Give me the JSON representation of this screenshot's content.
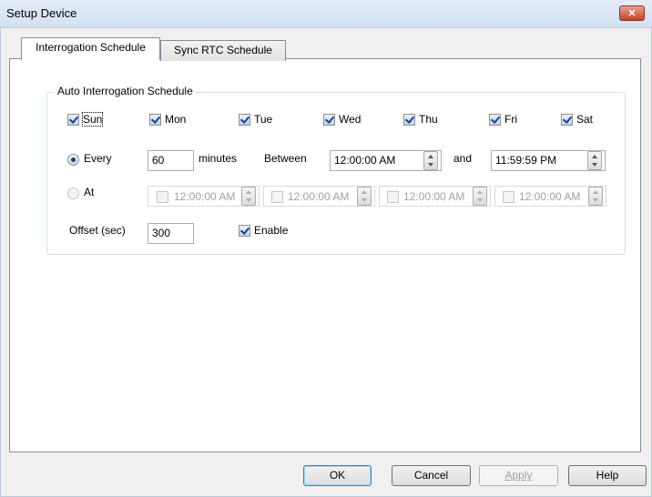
{
  "window": {
    "title": "Setup Device",
    "close_label": "✕"
  },
  "tabs": [
    {
      "label": "Interrogation Schedule",
      "active": true
    },
    {
      "label": "Sync RTC Schedule",
      "active": false
    }
  ],
  "group": {
    "title": "Auto Interrogation Schedule",
    "days": [
      {
        "label": "Sun",
        "checked": true
      },
      {
        "label": "Mon",
        "checked": true
      },
      {
        "label": "Tue",
        "checked": true
      },
      {
        "label": "Wed",
        "checked": true
      },
      {
        "label": "Thu",
        "checked": true
      },
      {
        "label": "Fri",
        "checked": true
      },
      {
        "label": "Sat",
        "checked": true
      }
    ],
    "every": {
      "label": "Every",
      "selected": true,
      "value": "60",
      "unit_label": "minutes",
      "between_label": "Between",
      "start_time": "12:00:00 AM",
      "and_label": "and",
      "end_time": "11:59:59 PM"
    },
    "at": {
      "label": "At",
      "selected": false,
      "times": [
        "12:00:00 AM",
        "12:00:00 AM",
        "12:00:00 AM",
        "12:00:00 AM"
      ]
    },
    "offset": {
      "label": "Offset (sec)",
      "value": "300"
    },
    "enable": {
      "label": "Enable",
      "checked": true
    }
  },
  "buttons": {
    "ok": "OK",
    "cancel": "Cancel",
    "apply": "Apply",
    "help": "Help"
  }
}
